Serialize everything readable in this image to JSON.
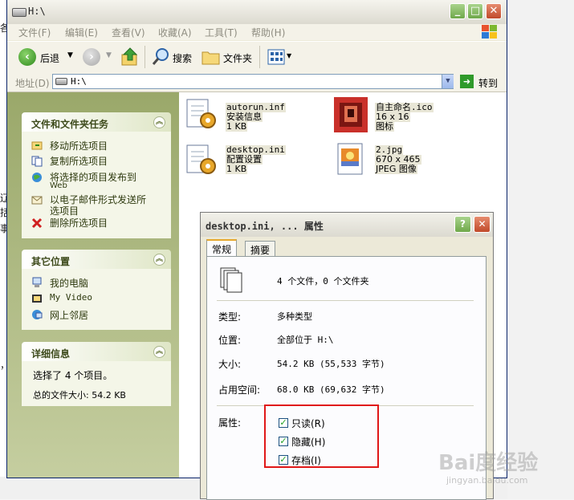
{
  "window": {
    "title": "H:\\",
    "menus": [
      "文件(F)",
      "编辑(E)",
      "查看(V)",
      "收藏(A)",
      "工具(T)",
      "帮助(H)"
    ]
  },
  "toolbar": {
    "back_label": "后退",
    "search_label": "搜索",
    "folders_label": "文件夹"
  },
  "address": {
    "label": "地址(D)",
    "value": "H:\\",
    "go_label": "转到"
  },
  "panels": {
    "tasks": {
      "title": "文件和文件夹任务",
      "items": [
        "移动所选项目",
        "复制所选项目",
        "将选择的项目发布到",
        "Web",
        "以电子邮件形式发送所",
        "选项目",
        "删除所选项目"
      ]
    },
    "places": {
      "title": "其它位置",
      "items": [
        "我的电脑",
        "My Video",
        "网上邻居"
      ]
    },
    "details": {
      "title": "详细信息",
      "line1": "选择了 4 个项目。",
      "line2": "总的文件大小: 54.2 KB"
    }
  },
  "files": [
    {
      "name": "autorun.inf",
      "type": "安装信息",
      "size": "1 KB"
    },
    {
      "name": "自主命名.ico",
      "type": "16 x 16",
      "size": "图标"
    },
    {
      "name": "desktop.ini",
      "type": "配置设置",
      "size": "1 KB"
    },
    {
      "name": "2.jpg",
      "type": "670 x 465",
      "size": "JPEG 图像"
    }
  ],
  "dialog": {
    "title": "desktop.ini, ... 属性",
    "tabs": [
      "常规",
      "摘要"
    ],
    "summary": "4 个文件，0 个文件夹",
    "rows": [
      {
        "label": "类型:",
        "value": "多种类型"
      },
      {
        "label": "位置:",
        "value": "全部位于 H:\\"
      },
      {
        "label": "大小:",
        "value": "54.2 KB (55,533 字节)"
      },
      {
        "label": "占用空间:",
        "value": "68.0 KB (69,632 字节)"
      }
    ],
    "attributes_label": "属性:",
    "attributes": [
      {
        "label": "只读(R)",
        "checked": true
      },
      {
        "label": "隐藏(H)",
        "checked": true
      },
      {
        "label": "存档(I)",
        "checked": true
      }
    ]
  },
  "background_fragments": [
    "各",
    "辽",
    "括",
    "事",
    "，"
  ],
  "watermark": {
    "main": "Bai度经验",
    "sub": "jingyan.baidu.com"
  },
  "colors": {
    "highlight": "#e01818",
    "xp_green": "#6fa84a",
    "xp_red": "#c04a2a"
  }
}
